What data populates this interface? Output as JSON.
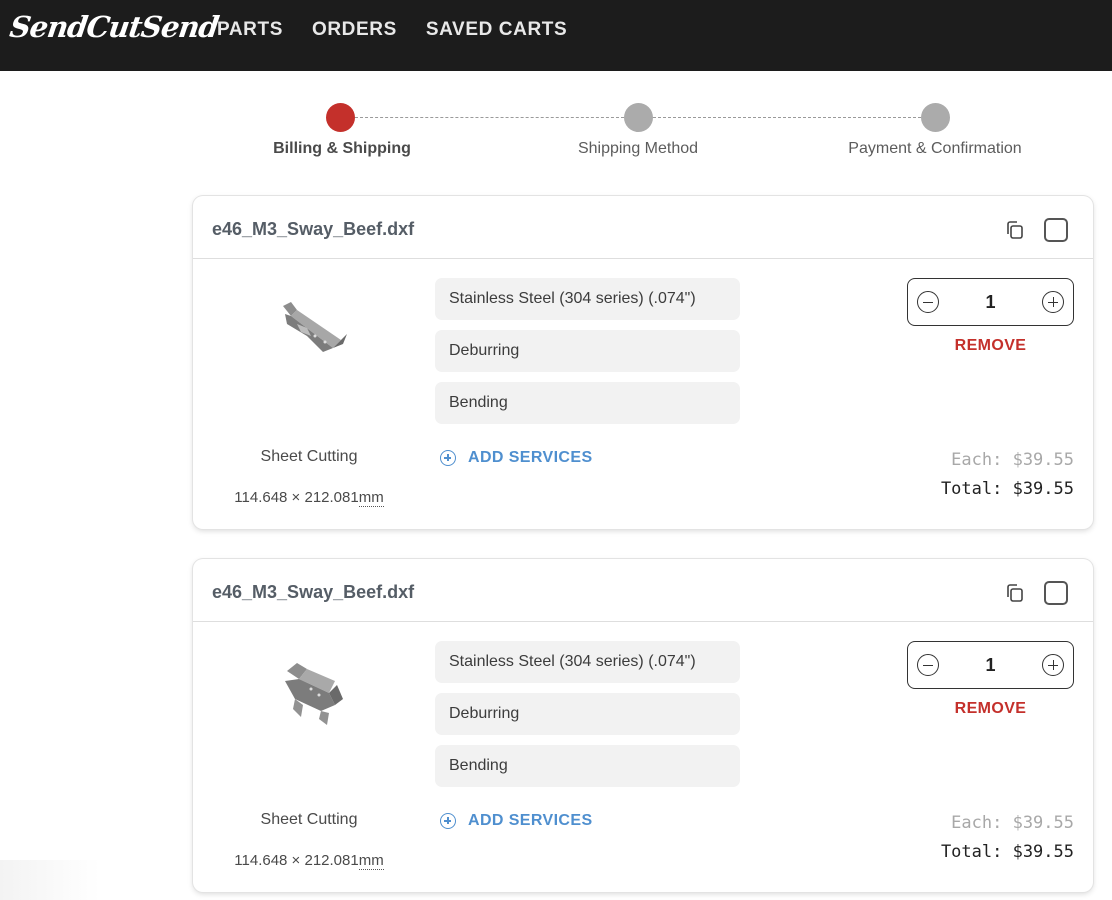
{
  "brand": {
    "logo_text": "SendCutSend"
  },
  "nav": {
    "items": [
      "PARTS",
      "ORDERS",
      "SAVED CARTS"
    ]
  },
  "steps": [
    {
      "label": "Billing & Shipping",
      "active": true
    },
    {
      "label": "Shipping Method",
      "active": false
    },
    {
      "label": "Payment & Confirmation",
      "active": false
    }
  ],
  "colors": {
    "accent_red": "#c4302b",
    "link_blue": "#4f8fcf",
    "navbar": "#1c1c1c",
    "inactive_step": "#ababab"
  },
  "icons": {
    "copy": "copy-icon",
    "add": "plus-circle-icon",
    "decrease": "minus-circle-icon",
    "increase": "plus-circle-icon"
  },
  "cart": {
    "items": [
      {
        "filename": "e46_M3_Sway_Beef.dxf",
        "options": [
          "Stainless Steel (304 series) (.074\")",
          "Deburring",
          "Bending"
        ],
        "add_services_label": "ADD SERVICES",
        "process": "Sheet Cutting",
        "dimensions": "114.648 × 212.081",
        "unit": "mm",
        "quantity": "1",
        "remove_label": "REMOVE",
        "each": "Each: $39.55",
        "total": "Total: $39.55"
      },
      {
        "filename": "e46_M3_Sway_Beef.dxf",
        "options": [
          "Stainless Steel (304 series) (.074\")",
          "Deburring",
          "Bending"
        ],
        "add_services_label": "ADD SERVICES",
        "process": "Sheet Cutting",
        "dimensions": "114.648 × 212.081",
        "unit": "mm",
        "quantity": "1",
        "remove_label": "REMOVE",
        "each": "Each: $39.55",
        "total": "Total: $39.55"
      }
    ]
  }
}
